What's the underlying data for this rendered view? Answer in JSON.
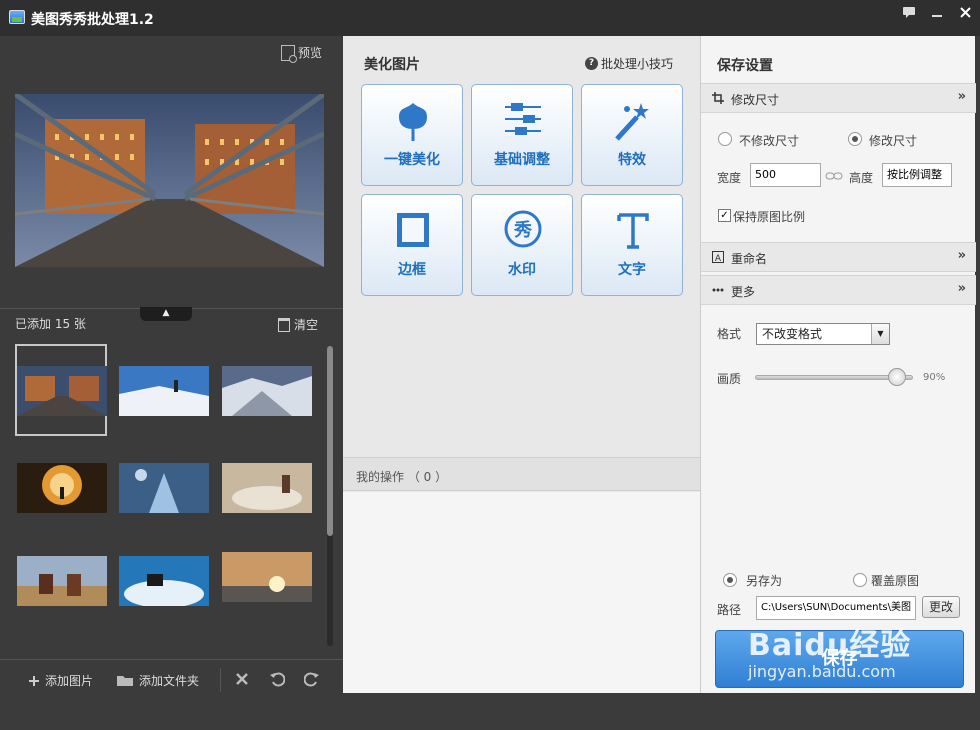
{
  "app": {
    "title": "美图秀秀批处理1.2"
  },
  "left": {
    "preview_label": "预览",
    "added_count": "已添加 15 张",
    "clear_label": "清空",
    "add_image_label": "添加图片",
    "add_folder_label": "添加文件夹"
  },
  "center": {
    "heading": "美化图片",
    "tips_label": "批处理小技巧",
    "tools": [
      {
        "label": "一键美化",
        "icon": "tulip-icon"
      },
      {
        "label": "基础调整",
        "icon": "sliders-icon"
      },
      {
        "label": "特效",
        "icon": "magic-wand-icon"
      },
      {
        "label": "边框",
        "icon": "frame-icon"
      },
      {
        "label": "水印",
        "icon": "watermark-icon"
      },
      {
        "label": "文字",
        "icon": "text-icon"
      }
    ],
    "operations_label": "我的操作 （ 0 ）"
  },
  "right": {
    "title": "保存设置",
    "resize": {
      "title": "修改尺寸",
      "opt_no_resize": "不修改尺寸",
      "opt_resize": "修改尺寸",
      "width_label": "宽度",
      "width_value": "500",
      "height_label": "高度",
      "height_value": "按比例调整",
      "keep_ratio_label": "保持原图比例"
    },
    "rename": {
      "title": "重命名"
    },
    "more": {
      "title": "更多",
      "format_label": "格式",
      "format_value": "不改变格式",
      "quality_label": "画质",
      "quality_value": "90%",
      "quality_level": 0.9
    },
    "save_as_label": "另存为",
    "overwrite_label": "覆盖原图",
    "path_label": "路径",
    "path_value": "C:\\Users\\SUN\\Documents\\美图",
    "change_label": "更改",
    "save_label": "保存"
  },
  "watermark": {
    "brand": "Baidu经验",
    "url": "jingyan.baidu.com"
  },
  "colors": {
    "accent": "#1e6fc1",
    "save_button": "#3d8ee0",
    "dark_bg": "#3b3b3b"
  }
}
